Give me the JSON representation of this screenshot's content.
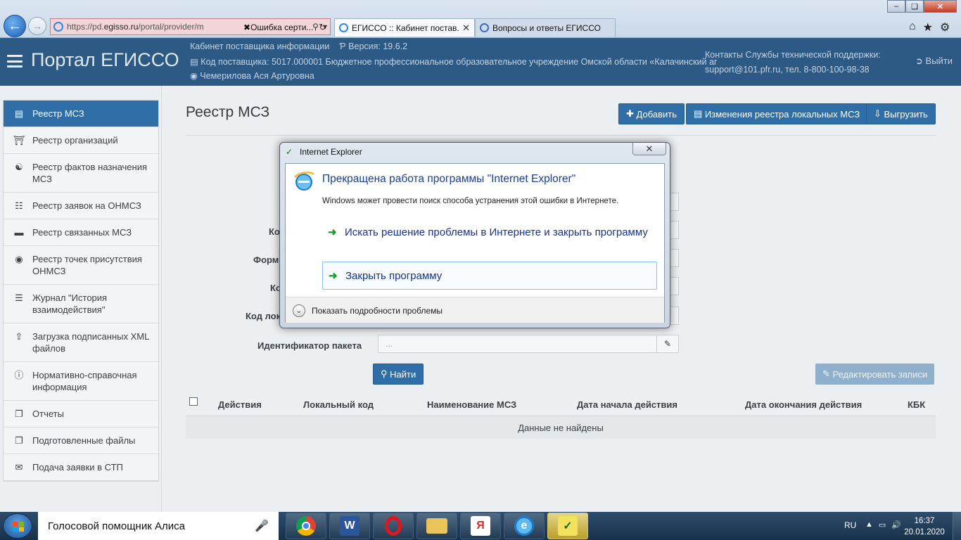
{
  "browser": {
    "address_url_prefix": "https://pd.",
    "address_url_domain": "egisso.ru",
    "address_url_suffix": "/portal/provider/m",
    "tabs": [
      {
        "label": "Ошибка серти...",
        "kind": "cert"
      },
      {
        "label": "ЕГИССО :: Кабинет постав...",
        "active": true
      },
      {
        "label": "Вопросы и ответы ЕГИССО",
        "active": false
      }
    ]
  },
  "header": {
    "title": "Портал ЕГИССО",
    "cabinet": "Кабинет поставщика информации",
    "version": "Версия: 19.6.2",
    "supplier": "Код поставщика: 5017.000001 Бюджетное профессиональное образовательное учреждение Омской области «Калачинский аг",
    "user": "Чемерилова Ася Артуровна",
    "support_title": "Контакты Службы технической поддержки:",
    "support_contacts": "support@101.pfr.ru, тел. 8-800-100-98-38",
    "logout": "Выйти"
  },
  "sidebar": {
    "items": [
      {
        "label": "Реестр МСЗ",
        "icon": "book-icon",
        "active": true
      },
      {
        "label": "Реестр организаций",
        "icon": "institution-icon"
      },
      {
        "label": "Реестр фактов назначения МСЗ",
        "icon": "handshake-icon"
      },
      {
        "label": "Реестр заявок на ОНМСЗ",
        "icon": "document-icon"
      },
      {
        "label": "Реестр связанных МСЗ",
        "icon": "card-icon"
      },
      {
        "label": "Реестр точек присутствия ОНМСЗ",
        "icon": "dot-circle-icon"
      },
      {
        "label": "Журнал \"История взаимодействия\"",
        "icon": "list-icon"
      },
      {
        "label": "Загрузка подписанных XML файлов",
        "icon": "upload-icon"
      },
      {
        "label": "Нормативно-справочная информация",
        "icon": "info-icon"
      },
      {
        "label": "Отчеты",
        "icon": "copy-icon"
      },
      {
        "label": "Подготовленные файлы",
        "icon": "files-icon"
      },
      {
        "label": "Подача заявки в СТП",
        "icon": "envelope-icon"
      }
    ]
  },
  "main": {
    "title": "Реестр МСЗ",
    "buttons": {
      "add": "Добавить",
      "changes": "Изменения реестра локальных МСЗ",
      "export": "Выгрузить",
      "search": "Найти",
      "edit": "Редактировать записи"
    },
    "labels": {
      "kod1": "Ко",
      "form": "Форм",
      "kod2": "Ко",
      "kod_lok": "Код лок",
      "package": "Идентификатор пакета"
    },
    "package_placeholder": "...",
    "columns": [
      "Действия",
      "Локальный код",
      "Наименование МСЗ",
      "Дата начала действия",
      "Дата окончания действия",
      "КБК"
    ],
    "empty_text": "Данные не найдены"
  },
  "dialog": {
    "window_title": "Internet Explorer",
    "heading": "Прекращена работа программы \"Internet Explorer\"",
    "subtitle": "Windows может провести поиск способа устранения этой ошибки в Интернете.",
    "option_search": "Искать решение проблемы в Интернете и закрыть программу",
    "option_close": "Закрыть программу",
    "details": "Показать подробности проблемы"
  },
  "taskbar": {
    "assistant": "Голосовой помощник Алиса",
    "apps": [
      "chrome-icon",
      "word-icon",
      "opera-icon",
      "explorer-icon",
      "yandex-icon",
      "ie-icon",
      "egisso-signer-icon"
    ],
    "lang": "RU",
    "time": "16:37",
    "date": "20.01.2020"
  },
  "colors": {
    "header_bg": "#2c5a85",
    "accent": "#2f6ea6",
    "dialog_link": "#17338a"
  }
}
